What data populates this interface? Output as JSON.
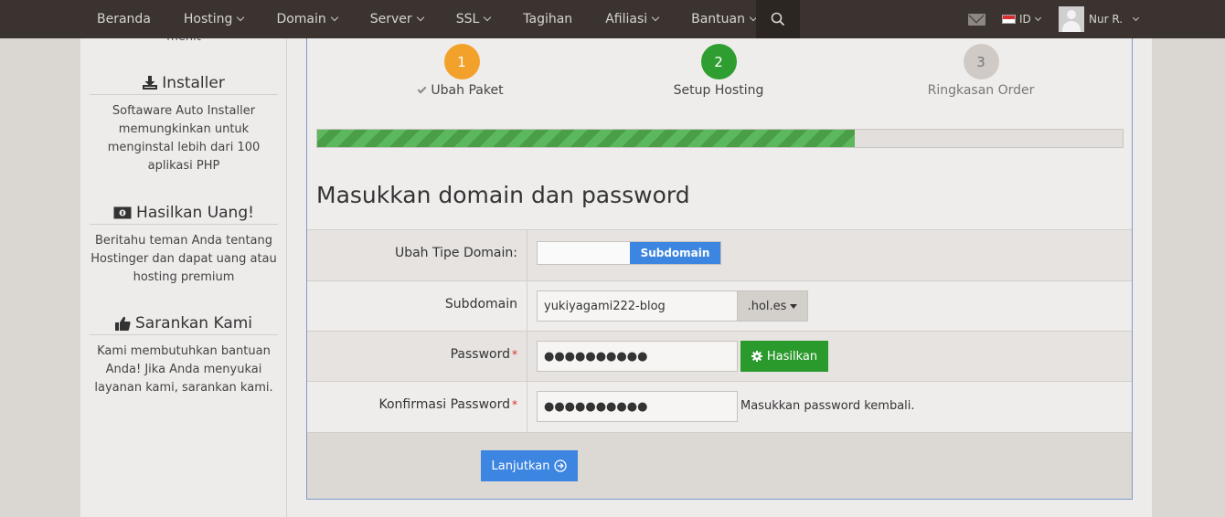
{
  "navbar": {
    "items": [
      {
        "label": "Beranda",
        "dropdown": false
      },
      {
        "label": "Hosting",
        "dropdown": true
      },
      {
        "label": "Domain",
        "dropdown": true
      },
      {
        "label": "Server",
        "dropdown": true
      },
      {
        "label": "SSL",
        "dropdown": true
      },
      {
        "label": "Tagihan",
        "dropdown": false
      },
      {
        "label": "Afiliasi",
        "dropdown": true
      },
      {
        "label": "Bantuan",
        "dropdown": true
      }
    ],
    "language": "ID",
    "user_name": "Nur R."
  },
  "sidebar": {
    "cut_text": "menit",
    "sections": [
      {
        "icon": "download-icon",
        "title": "Installer",
        "text": "Softaware Auto Installer memungkinkan untuk menginstal lebih dari 100 aplikasi PHP"
      },
      {
        "icon": "money-icon",
        "title": "Hasilkan Uang!",
        "text": "Beritahu teman Anda tentang Hostinger dan dapat uang atau hosting premium"
      },
      {
        "icon": "thumbs-up-icon",
        "title": "Sarankan Kami",
        "text": "Kami membutuhkan bantuan Anda! Jika Anda menyukai layanan kami, sarankan kami."
      }
    ]
  },
  "steps": [
    {
      "number": "1",
      "label": "Ubah Paket",
      "state": "done"
    },
    {
      "number": "2",
      "label": "Setup Hosting",
      "state": "current"
    },
    {
      "number": "3",
      "label": "Ringkasan Order",
      "state": "todo"
    }
  ],
  "progress": {
    "fraction": 0.667
  },
  "form": {
    "title": "Masukkan domain dan password",
    "domain_type_label": "Ubah Tipe Domain:",
    "domain_type_option": "Subdomain",
    "subdomain_label": "Subdomain",
    "subdomain_value": "yukiyagami222-blog",
    "domain_suffix": ".hol.es",
    "password_label": "Password",
    "password_mask": "●●●●●●●●●●",
    "generate_label": "Hasilkan",
    "confirm_label": "Konfirmasi Password",
    "confirm_mask": "●●●●●●●●●●",
    "confirm_help": "Masukkan password kembali.",
    "submit_label": "Lanjutkan",
    "required_mark": "*"
  },
  "colors": {
    "navbar": "#3b332f",
    "step_done": "#f2a12b",
    "step_current": "#2f9e30",
    "primary_blue": "#3c85e0",
    "success_green": "#2b9a2c"
  }
}
